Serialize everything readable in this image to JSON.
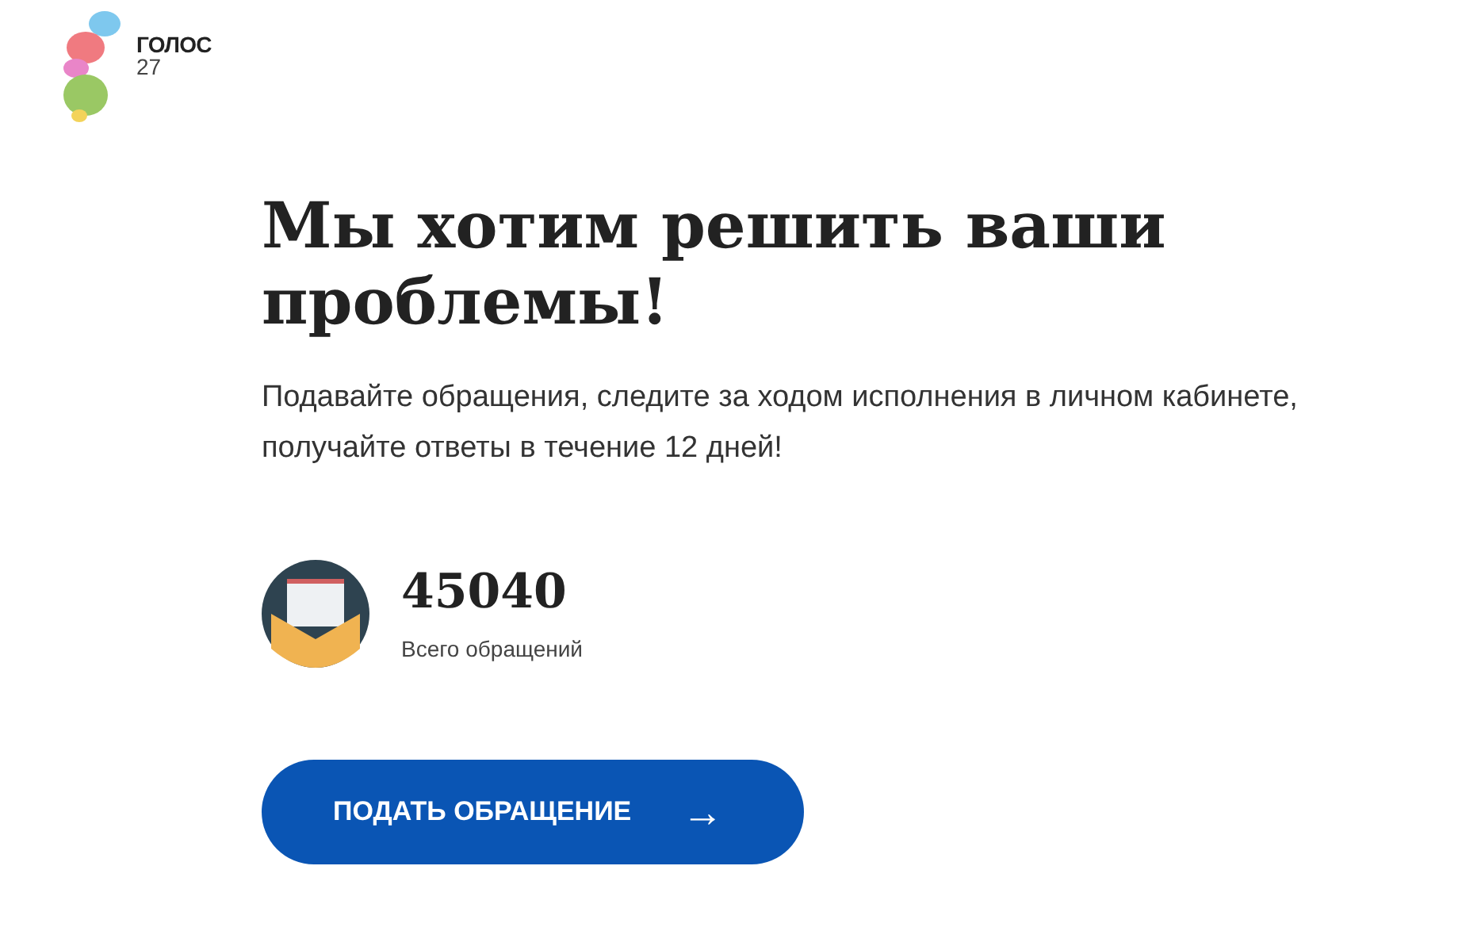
{
  "logo": {
    "name": "ГОЛОС",
    "number": "27"
  },
  "heading": "Мы хотим решить ваши проблемы!",
  "description": "Подавайте обращения, следите за ходом исполнения в личном кабинете, получайте ответы в течение 12 дней!",
  "stat": {
    "value": "45040",
    "label": "Всего обращений"
  },
  "button": {
    "label": "ПОДАТЬ ОБРАЩЕНИЕ",
    "arrow": "→"
  }
}
